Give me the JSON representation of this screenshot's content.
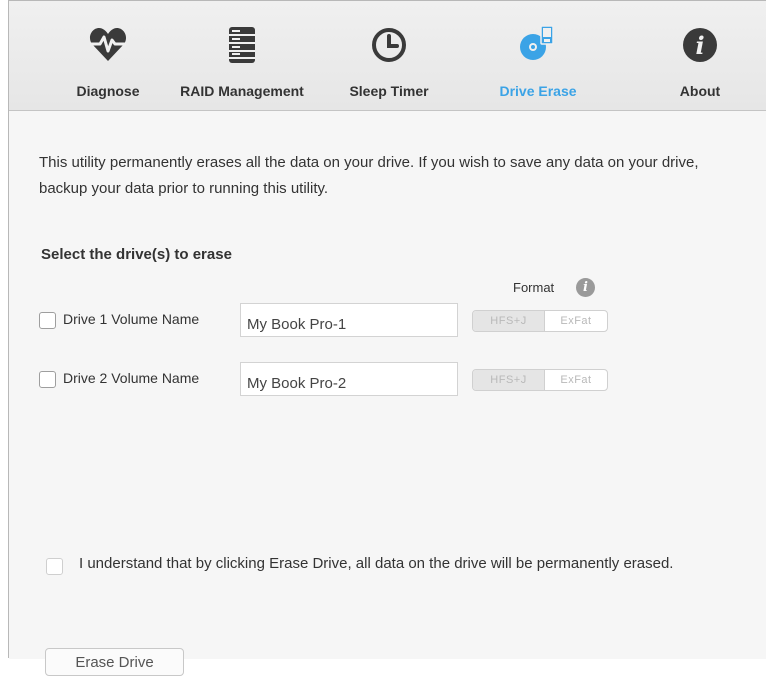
{
  "toolbar": {
    "tabs": [
      {
        "label": "Diagnose",
        "icon": "heartbeat-icon"
      },
      {
        "label": "RAID Management",
        "icon": "stack-icon"
      },
      {
        "label": "Sleep Timer",
        "icon": "clock-icon"
      },
      {
        "label": "Drive Erase",
        "icon": "disk-erase-icon",
        "active": true
      },
      {
        "label": "About",
        "icon": "info-icon"
      }
    ],
    "active_color": "#3ba3e6"
  },
  "intro_text": "This utility permanently erases all the data on your drive. If you wish to save any data on your drive, backup your data prior to running this utility.",
  "select_title": "Select the drive(s) to erase",
  "format_label": "Format",
  "format_info_glyph": "i",
  "drives": [
    {
      "label": "Drive 1 Volume Name",
      "value": "My Book Pro-1",
      "checked": false,
      "format_options": [
        "HFS+J",
        "ExFat"
      ],
      "selected_format": "HFS+J"
    },
    {
      "label": "Drive 2 Volume Name",
      "value": "My Book Pro-2",
      "checked": false,
      "format_options": [
        "HFS+J",
        "ExFat"
      ],
      "selected_format": "HFS+J"
    }
  ],
  "acknowledge_text": "I understand that by clicking Erase Drive, all data on the drive will be permanently erased.",
  "erase_button": "Erase Drive"
}
